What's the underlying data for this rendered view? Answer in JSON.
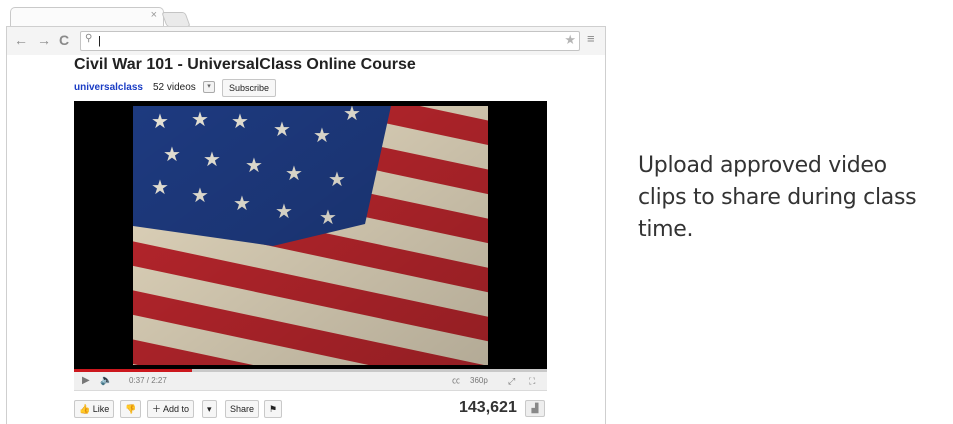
{
  "browser": {
    "tab_close": "×",
    "omnibox_value": "|",
    "icons": {
      "back": "←",
      "forward": "→",
      "reload": "C",
      "search": "⚲",
      "star": "★",
      "menu": "≡"
    }
  },
  "video": {
    "title": "Civil War 101 - UniversalClass Online Course",
    "channel": "universalclass",
    "video_count": "52 videos",
    "subscribe_label": "Subscribe",
    "time": "0:37 / 2:27",
    "quality": "360p",
    "progress": 0.25,
    "actions": {
      "like": "Like",
      "add_to": "Add to",
      "share": "Share"
    },
    "views": "143,621"
  },
  "caption": "Upload approved video clips to share during class time."
}
